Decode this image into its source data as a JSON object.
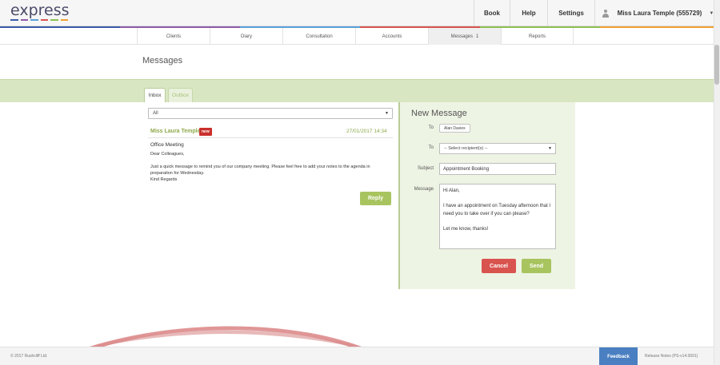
{
  "app": {
    "logo_text": "express",
    "logo_colors": [
      "#3b5ba9",
      "#8e5aa8",
      "#5aa0d8",
      "#d9534f",
      "#8cc152",
      "#f0a030"
    ]
  },
  "topnav": {
    "book": "Book",
    "help": "Help",
    "settings": "Settings",
    "user": "Miss Laura Temple (555729)"
  },
  "subnav": {
    "items": [
      {
        "label": "Clients"
      },
      {
        "label": "Diary"
      },
      {
        "label": "Consultation"
      },
      {
        "label": "Accounts"
      },
      {
        "label": "Messages",
        "count": "1"
      },
      {
        "label": "Reports"
      }
    ],
    "active": "Messages"
  },
  "page": {
    "title": "Messages"
  },
  "tabs": {
    "inbox": "Inbox",
    "outbox": "Outbox"
  },
  "inbox": {
    "filter_value": "All",
    "message": {
      "sender": "Miss Laura Temple",
      "badge": "new",
      "date": "27/01/2017 14:34",
      "subject": "Office Meeting",
      "body": "Dear Colleagues,\n\nJust a quick message to remind you of our company meeting. Please feel free to add your notes to the agenda in preparation for Wednesday.\nKind Regards"
    },
    "reply_label": "Reply"
  },
  "compose": {
    "title": "New Message",
    "to_label": "To",
    "to_chip": "Alan Davies",
    "to_label_2": "To",
    "recipient_placeholder": "-- Select recipient(s) --",
    "subject_label": "Subject",
    "subject_value": "Appointment Booking",
    "message_label": "Message",
    "message_value": "Hi Alan,\n\nI have an appointment on Tuesday afternoon that I need you to take over if you can please?\n\nLet me know, thanks!",
    "cancel_label": "Cancel",
    "send_label": "Send"
  },
  "footer": {
    "copyright": "© 2017 Rushcliff Ltd.",
    "feedback": "Feedback",
    "release_notes": "Release Notes (PS-v14.0001)"
  }
}
